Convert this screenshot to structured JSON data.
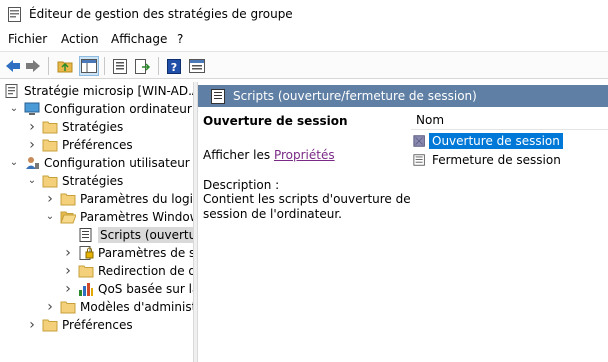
{
  "window": {
    "title": "Éditeur de gestion des stratégies de groupe"
  },
  "menu": [
    "Fichier",
    "Action",
    "Affichage",
    "?"
  ],
  "toolbar": {
    "buttons": [
      "back-icon",
      "forward-icon",
      "up-folder-icon",
      "show-hide-tree-icon",
      "properties-icon",
      "export-list-icon",
      "help-icon",
      "console-view-icon"
    ]
  },
  "tree": [
    {
      "label": "Stratégie microsip [WIN-AD.AD",
      "icon": "policy-icon",
      "expander": ""
    },
    {
      "label": "Configuration ordinateur",
      "icon": "computer-icon",
      "expander": "v"
    },
    {
      "label": "Stratégies",
      "icon": "folder-icon",
      "expander": ">"
    },
    {
      "label": "Préférences",
      "icon": "folder-icon",
      "expander": ">"
    },
    {
      "label": "Configuration utilisateur",
      "icon": "user-icon",
      "expander": "v"
    },
    {
      "label": "Stratégies",
      "icon": "folder-icon",
      "expander": "v"
    },
    {
      "label": "Paramètres du logici",
      "icon": "folder-icon",
      "expander": ">"
    },
    {
      "label": "Paramètres Windows",
      "icon": "folder-open-icon",
      "expander": "v"
    },
    {
      "label": "Scripts (ouverture",
      "icon": "script-icon",
      "expander": ""
    },
    {
      "label": "Paramètres de sé",
      "icon": "security-icon",
      "expander": ">"
    },
    {
      "label": "Redirection de do",
      "icon": "folder-icon",
      "expander": ">"
    },
    {
      "label": "QoS basée sur la",
      "icon": "chart-icon",
      "expander": ">"
    },
    {
      "label": "Modèles d'administr",
      "icon": "folder-icon",
      "expander": ">"
    },
    {
      "label": "Préférences",
      "icon": "folder-icon",
      "expander": ">"
    }
  ],
  "detail": {
    "header": "Scripts (ouverture/fermeture de session)",
    "title": "Ouverture de session",
    "show_prefix": "Afficher les ",
    "show_link": "Propriétés",
    "description_label": "Description :",
    "description_line1": "Contient les scripts d'ouverture de",
    "description_line2": "session de l'ordinateur."
  },
  "list": {
    "column": "Nom",
    "items": [
      {
        "label": "Ouverture de session",
        "icon": "script-item-icon"
      },
      {
        "label": "Fermeture de session",
        "icon": "script-item-icon"
      }
    ]
  }
}
